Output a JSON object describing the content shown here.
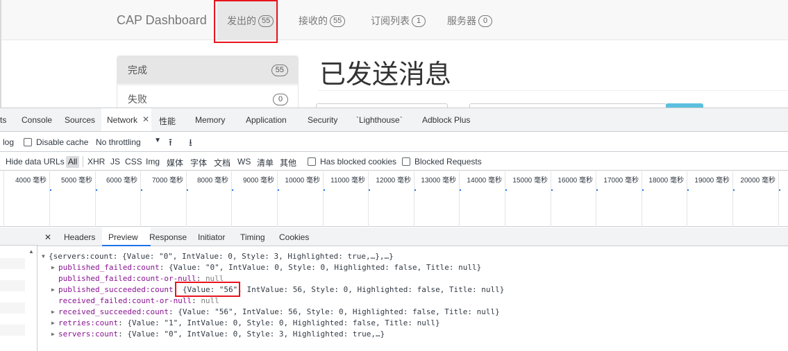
{
  "dashboard": {
    "brand": "CAP Dashboard",
    "nav": [
      {
        "label": "发出的",
        "badge": "55"
      },
      {
        "label": "接收的",
        "badge": "55"
      },
      {
        "label": "订阅列表",
        "badge": "1"
      },
      {
        "label": "服务器",
        "badge": "0"
      }
    ],
    "sidebar": [
      {
        "label": "完成",
        "badge": "55"
      },
      {
        "label": "失败",
        "badge": "0"
      }
    ],
    "page_title": "已发送消息"
  },
  "devtools": {
    "tabs": [
      "ts",
      "Console",
      "Sources",
      "Network",
      "性能",
      "Memory",
      "Application",
      "Security",
      "`Lighthouse`",
      "Adblock Plus"
    ],
    "active_tab": "Network",
    "toolbar": {
      "log_label": "log",
      "disable_cache_label": "Disable cache",
      "throttling_value": "No throttling"
    },
    "filters": {
      "hide_data_urls": "Hide data URLs",
      "types": [
        "All",
        "XHR",
        "JS",
        "CSS",
        "Img",
        "媒体",
        "字体",
        "文档",
        "WS",
        "清单",
        "其他"
      ],
      "has_blocked_cookies": "Has blocked cookies",
      "blocked_requests": "Blocked Requests"
    },
    "timeline_ticks": [
      "4000 毫秒",
      "5000 毫秒",
      "6000 毫秒",
      "7000 毫秒",
      "8000 毫秒",
      "9000 毫秒",
      "10000 毫秒",
      "11000 毫秒",
      "12000 毫秒",
      "13000 毫秒",
      "14000 毫秒",
      "15000 毫秒",
      "16000 毫秒",
      "17000 毫秒",
      "18000 毫秒",
      "19000 毫秒",
      "20000 毫秒",
      "2"
    ],
    "detail_tabs": [
      "Headers",
      "Preview",
      "Response",
      "Initiator",
      "Timing",
      "Cookies"
    ],
    "active_detail_tab": "Preview",
    "preview": {
      "root": "{servers:count: {Value: \"0\", IntValue: 0, Style: 3, Highlighted: true,…},…}",
      "lines": [
        {
          "key": "published_failed:count",
          "value": "{Value: \"0\", IntValue: 0, Style: 0, Highlighted: false, Title: null}",
          "expandable": true
        },
        {
          "key": "published_failed:count-or-null",
          "value": "null",
          "expandable": false
        },
        {
          "key": "published_succeeded:count",
          "value": "{Value: \"56\", IntValue: 56, Style: 0, Highlighted: false, Title: null}",
          "expandable": true
        },
        {
          "key": "received_failed:count-or-null",
          "value": "null",
          "expandable": false
        },
        {
          "key": "received_succeeded:count",
          "value": "{Value: \"56\", IntValue: 56, Style: 0, Highlighted: false, Title: null}",
          "expandable": true
        },
        {
          "key": "retries:count",
          "value": "{Value: \"1\", IntValue: 0, Style: 0, Highlighted: false, Title: null}",
          "expandable": true
        },
        {
          "key": "servers:count",
          "value": "{Value: \"0\", IntValue: 0, Style: 3, Highlighted: true,…}",
          "expandable": true
        }
      ]
    }
  },
  "colors": {
    "highlight_box": "#e8131c",
    "accent": "#1a73e8",
    "json_key": "#881391"
  }
}
